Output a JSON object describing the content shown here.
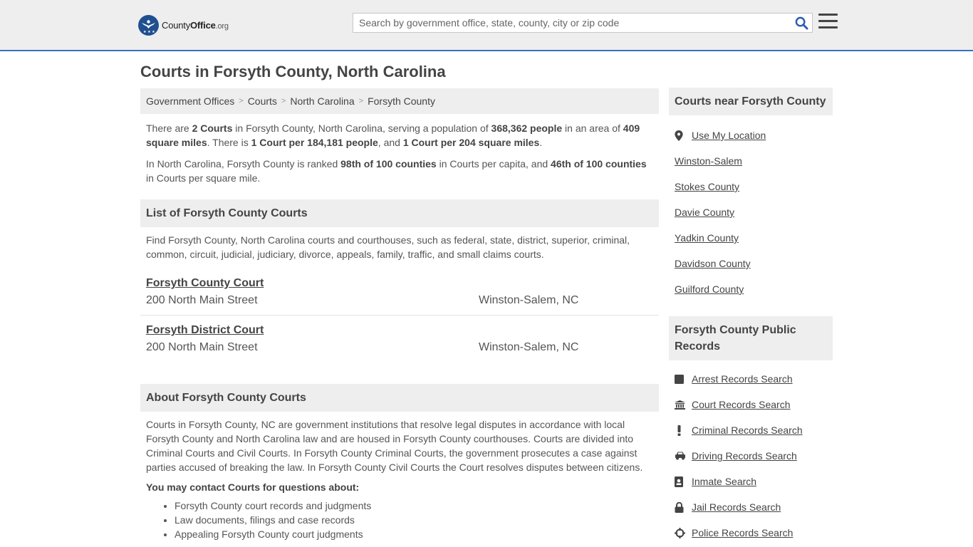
{
  "header": {
    "logo": {
      "county": "County",
      "office": "Office",
      "org": ".org"
    },
    "search_placeholder": "Search by government office, state, county, city or zip code"
  },
  "page_title": "Courts in Forsyth County, North Carolina",
  "breadcrumb": [
    "Government Offices",
    "Courts",
    "North Carolina",
    "Forsyth County"
  ],
  "intro": {
    "p1": {
      "t1": "There are ",
      "b1": "2 Courts",
      "t2": " in Forsyth County, North Carolina, serving a population of ",
      "b2": "368,362 people",
      "t3": " in an area of ",
      "b3": "409 square miles",
      "t4": ". There is ",
      "b4": "1 Court per 184,181 people",
      "t5": ", and ",
      "b5": "1 Court per 204 square miles",
      "t6": "."
    },
    "p2": {
      "t1": "In North Carolina, Forsyth County is ranked ",
      "b1": "98th of 100 counties",
      "t2": " in Courts per capita, and ",
      "b2": "46th of 100 counties",
      "t3": " in Courts per square mile."
    }
  },
  "list_section": {
    "title": "List of Forsyth County Courts",
    "description": "Find Forsyth County, North Carolina courts and courthouses, such as federal, state, district, superior, criminal, common, circuit, judicial, judiciary, divorce, appeals, family, traffic, and small claims courts.",
    "courts": [
      {
        "name": "Forsyth County Court",
        "address": "200 North Main Street",
        "city": "Winston-Salem, NC"
      },
      {
        "name": "Forsyth District Court",
        "address": "200 North Main Street",
        "city": "Winston-Salem, NC"
      }
    ]
  },
  "about_section": {
    "title": "About Forsyth County Courts",
    "text": "Courts in Forsyth County, NC are government institutions that resolve legal disputes in accordance with local Forsyth County and North Carolina law and are housed in Forsyth County courthouses. Courts are divided into Criminal Courts and Civil Courts. In Forsyth County Criminal Courts, the government prosecutes a case against parties accused of breaking the law. In Forsyth County Civil Courts the Court resolves disputes between citizens.",
    "contact_heading": "You may contact Courts for questions about:",
    "contact_items": [
      "Forsyth County court records and judgments",
      "Law documents, filings and case records",
      "Appealing Forsyth County court judgments"
    ]
  },
  "sidebar": {
    "nearby_title": "Courts near Forsyth County",
    "use_location": "Use My Location",
    "nearby": [
      "Winston-Salem",
      "Stokes County",
      "Davie County",
      "Yadkin County",
      "Davidson County",
      "Guilford County"
    ],
    "records_title": "Forsyth County Public Records",
    "records": [
      {
        "label": "Arrest Records Search",
        "icon": "square-icon"
      },
      {
        "label": "Court Records Search",
        "icon": "courthouse-icon"
      },
      {
        "label": "Criminal Records Search",
        "icon": "exclamation-icon"
      },
      {
        "label": "Driving Records Search",
        "icon": "car-icon"
      },
      {
        "label": "Inmate Search",
        "icon": "id-card-icon"
      },
      {
        "label": "Jail Records Search",
        "icon": "lock-icon"
      },
      {
        "label": "Police Records Search",
        "icon": "crosshair-icon"
      }
    ]
  },
  "colors": {
    "accent": "#3871c1",
    "panel": "#eeeeee",
    "text": "#444444"
  }
}
